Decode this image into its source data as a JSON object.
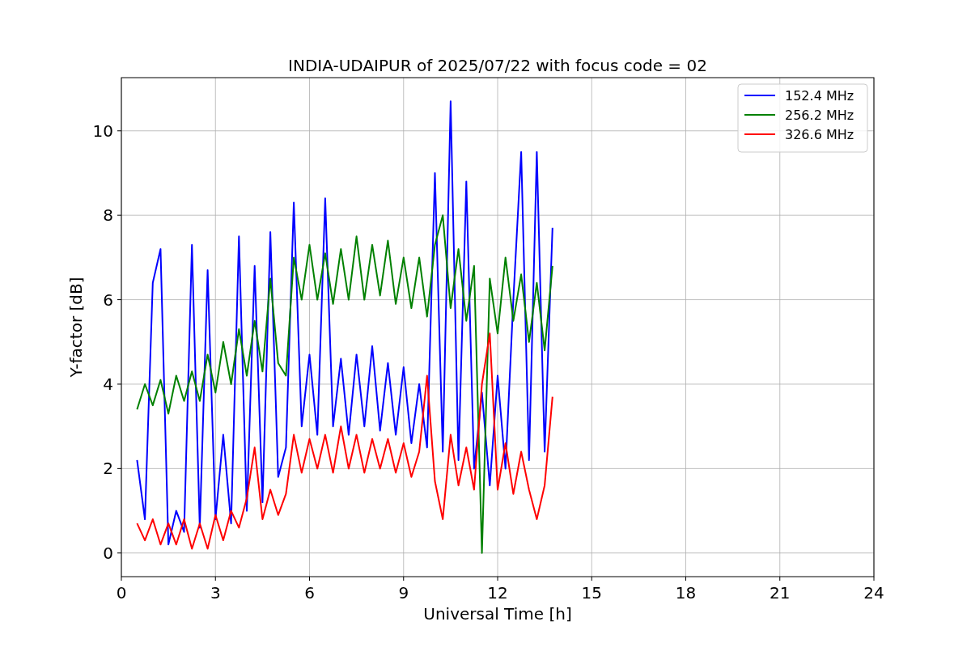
{
  "figure": {
    "chart_data": {
      "type": "line",
      "title": "INDIA-UDAIPUR of 2025/07/22 with focus code = 02",
      "xlabel": "Universal Time [h]",
      "ylabel": "Y-factor [dB]",
      "x": [
        0.5,
        0.75,
        1.0,
        1.25,
        1.5,
        1.75,
        2.0,
        2.25,
        2.5,
        2.75,
        3.0,
        3.25,
        3.5,
        3.75,
        4.0,
        4.25,
        4.5,
        4.75,
        5.0,
        5.25,
        5.5,
        5.75,
        6.0,
        6.25,
        6.5,
        6.75,
        7.0,
        7.25,
        7.5,
        7.75,
        8.0,
        8.25,
        8.5,
        8.75,
        9.0,
        9.25,
        9.5,
        9.75,
        10.0,
        10.25,
        10.5,
        10.75,
        11.0,
        11.25,
        11.5,
        11.75,
        12.0,
        12.25,
        12.5,
        12.75,
        13.0,
        13.25,
        13.5,
        13.75
      ],
      "series": [
        {
          "name": "152.4 MHz",
          "color": "#0000ff",
          "values": [
            2.2,
            0.8,
            6.4,
            7.2,
            0.2,
            1.0,
            0.5,
            7.3,
            0.6,
            6.7,
            0.8,
            2.8,
            0.7,
            7.5,
            1.0,
            6.8,
            1.2,
            7.6,
            1.8,
            2.5,
            8.3,
            3.0,
            4.7,
            2.8,
            8.4,
            3.0,
            4.6,
            2.8,
            4.7,
            3.0,
            4.9,
            2.9,
            4.5,
            2.8,
            4.4,
            2.6,
            4.0,
            2.5,
            9.0,
            2.4,
            10.7,
            2.2,
            8.8,
            2.0,
            3.8,
            1.6,
            4.2,
            2.0,
            6.0,
            9.5,
            2.2,
            9.5,
            2.4,
            7.7
          ]
        },
        {
          "name": "256.2 MHz",
          "color": "#008000",
          "values": [
            3.4,
            4.0,
            3.5,
            4.1,
            3.3,
            4.2,
            3.6,
            4.3,
            3.6,
            4.7,
            3.8,
            5.0,
            4.0,
            5.3,
            4.2,
            5.5,
            4.3,
            6.5,
            4.5,
            4.2,
            7.0,
            6.0,
            7.3,
            6.0,
            7.1,
            5.9,
            7.2,
            6.0,
            7.5,
            6.0,
            7.3,
            6.1,
            7.4,
            5.9,
            7.0,
            5.8,
            7.0,
            5.6,
            7.3,
            8.0,
            5.8,
            7.2,
            5.5,
            6.8,
            0.0,
            6.5,
            5.2,
            7.0,
            5.5,
            6.6,
            5.0,
            6.4,
            4.8,
            6.8
          ]
        },
        {
          "name": "326.6 MHz",
          "color": "#ff0000",
          "values": [
            0.7,
            0.3,
            0.8,
            0.2,
            0.7,
            0.2,
            0.8,
            0.1,
            0.7,
            0.1,
            0.9,
            0.3,
            1.0,
            0.6,
            1.3,
            2.5,
            0.8,
            1.5,
            0.9,
            1.4,
            2.8,
            1.9,
            2.7,
            2.0,
            2.8,
            1.9,
            3.0,
            2.0,
            2.8,
            1.9,
            2.7,
            2.0,
            2.7,
            1.9,
            2.6,
            1.8,
            2.4,
            4.2,
            1.7,
            0.8,
            2.8,
            1.6,
            2.5,
            1.5,
            4.0,
            5.2,
            1.5,
            2.6,
            1.4,
            2.4,
            1.5,
            0.8,
            1.6,
            3.7
          ]
        }
      ],
      "grid": true,
      "legend": true,
      "xlim": [
        0,
        24
      ],
      "ylim": [
        -0.56,
        11.26
      ],
      "xticks": [
        0,
        3,
        6,
        9,
        12,
        15,
        18,
        21,
        24
      ],
      "yticks": [
        0,
        2,
        4,
        6,
        8,
        10
      ]
    }
  }
}
